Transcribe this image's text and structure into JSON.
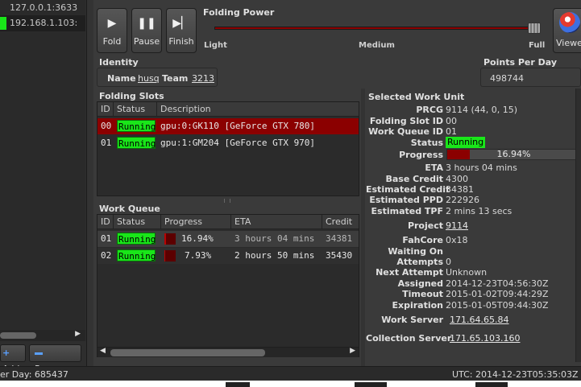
{
  "clients": [
    {
      "address": "127.0.0.1:3633"
    },
    {
      "address": "192.168.1.103:"
    }
  ],
  "left": {
    "add_label": "Add",
    "remove_label": "Remove"
  },
  "controls": {
    "fold": "Fold",
    "pause": "Pause",
    "finish": "Finish"
  },
  "power": {
    "title": "Folding Power",
    "light": "Light",
    "medium": "Medium",
    "full": "Full",
    "level_fraction": 1.0
  },
  "viewer": {
    "label": "Viewe"
  },
  "identity": {
    "title": "Identity",
    "name_label": "Name",
    "name_value": "husq",
    "team_label": "Team",
    "team_value": "3213"
  },
  "ppd": {
    "title": "Points Per Day",
    "value": "498744"
  },
  "slots": {
    "title": "Folding Slots",
    "headers": [
      "ID",
      "Status",
      "Description"
    ],
    "rows": [
      {
        "id": "00",
        "status": "Running",
        "description": "gpu:0:GK110 [GeForce GTX 780]"
      },
      {
        "id": "01",
        "status": "Running",
        "description": "gpu:1:GM204 [GeForce GTX 970]"
      }
    ]
  },
  "work_queue": {
    "title": "Work Queue",
    "headers": [
      "ID",
      "Status",
      "Progress",
      "ETA",
      "Credit"
    ],
    "rows": [
      {
        "id": "01",
        "status": "Running",
        "progress": "16.94%",
        "progress_value": 0.1694,
        "eta": "3 hours 04 mins",
        "credit": "34381"
      },
      {
        "id": "02",
        "status": "Running",
        "progress": "7.93%",
        "progress_value": 0.0793,
        "eta": "2 hours 50 mins",
        "credit": "35430"
      }
    ]
  },
  "work_unit": {
    "title": "Selected Work Unit",
    "fields": {
      "prcg": {
        "label": "PRCG",
        "value": "9114 (44, 0, 15)"
      },
      "slot": {
        "label": "Folding Slot ID",
        "value": "00"
      },
      "queue": {
        "label": "Work Queue ID",
        "value": "01"
      },
      "status": {
        "label": "Status",
        "value": "Running"
      },
      "progress": {
        "label": "Progress",
        "value": "16.94%",
        "fraction": 0.1694
      },
      "eta": {
        "label": "ETA",
        "value": "3 hours 04 mins"
      },
      "base_credit": {
        "label": "Base Credit",
        "value": "4300"
      },
      "est_credit": {
        "label": "Estimated Credit",
        "value": "34381"
      },
      "est_ppd": {
        "label": "Estimated PPD",
        "value": "222926"
      },
      "est_tpf": {
        "label": "Estimated TPF",
        "value": "2 mins 13 secs"
      },
      "project": {
        "label": "Project",
        "value": "9114"
      },
      "fahcore": {
        "label": "FahCore",
        "value": "0x18"
      },
      "waiting": {
        "label": "Waiting On",
        "value": ""
      },
      "attempts": {
        "label": "Attempts",
        "value": "0"
      },
      "next_attempt": {
        "label": "Next Attempt",
        "value": "Unknown"
      },
      "assigned": {
        "label": "Assigned",
        "value": "2014-12-23T04:56:30Z"
      },
      "timeout": {
        "label": "Timeout",
        "value": "2015-01-02T09:44:29Z"
      },
      "expiration": {
        "label": "Expiration",
        "value": "2015-01-05T09:44:30Z"
      },
      "work_server": {
        "label": "Work Server",
        "value": "171.64.65.84"
      },
      "collection_server": {
        "label": "Collection Server",
        "value": "171.65.103.160"
      }
    }
  },
  "status_bar": {
    "ppd": "er Day: 685437",
    "utc": "UTC: 2014-12-23T05:35:03Z"
  },
  "colors": {
    "running": "#19e619",
    "selected_row": "#8b0000",
    "progress_fill": "#b80000",
    "power_track": "#8b0000"
  }
}
